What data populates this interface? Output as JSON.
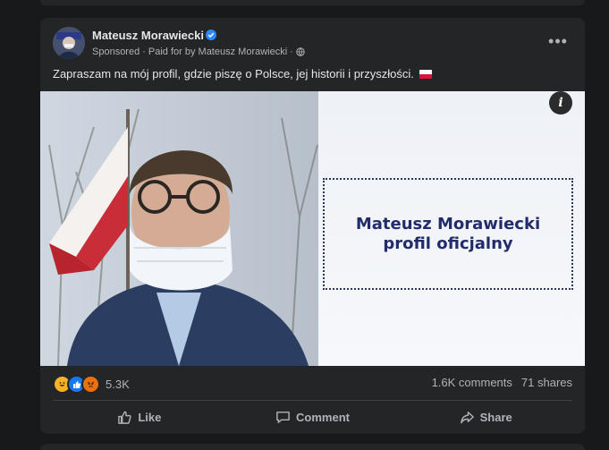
{
  "post": {
    "author": "Mateusz Morawiecki",
    "sponsored": "Sponsored",
    "paid_for": "Paid for by Mateusz Morawiecki",
    "separator": "·",
    "caption": "Zapraszam na mój profil, gdzie piszę o Polsce, jej historii i przyszłości.",
    "more_label": "•••",
    "info_label": "i"
  },
  "ad": {
    "name_line": "Mateusz Morawiecki",
    "sub_line": "profil oficjalny"
  },
  "engagement": {
    "reaction_count": "5.3K",
    "comments": "1.6K comments",
    "shares": "71 shares",
    "reaction_icons": [
      "haha-icon",
      "like-icon",
      "angry-icon"
    ]
  },
  "actions": {
    "like": "Like",
    "comment": "Comment",
    "share": "Share"
  },
  "colors": {
    "background": "#18191a",
    "card": "#242526",
    "text_primary": "#e4e6eb",
    "text_secondary": "#b0b3b8",
    "verified": "#2d88ff",
    "ad_text": "#222c6a"
  }
}
